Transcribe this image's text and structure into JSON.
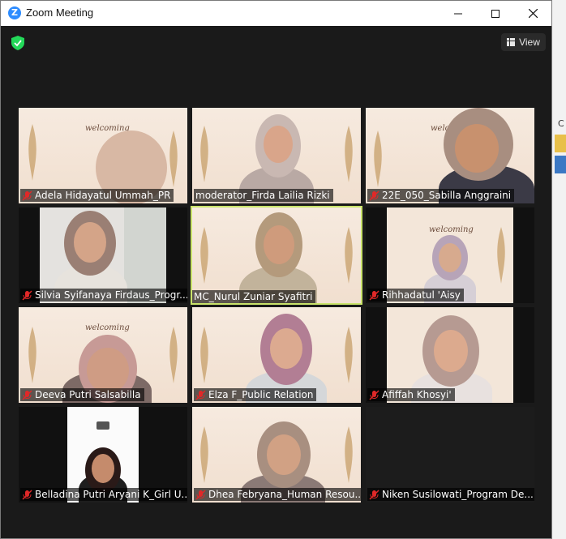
{
  "window": {
    "title": "Zoom Meeting",
    "logo_letter": "Z",
    "controls": [
      "minimize",
      "maximize",
      "close"
    ]
  },
  "toolbar": {
    "view_label": "View",
    "view_icon": "grid-icon",
    "security_icon": "shield-check-icon"
  },
  "desktop": {
    "edge_letter": "C"
  },
  "colors": {
    "accent_active": "#c9e36a",
    "mute_red": "#e02828",
    "zoom_blue": "#2d8cff",
    "shield_green": "#23d959"
  },
  "participants": [
    {
      "name": "Adela Hidayatul Ummah_PR",
      "muted": true
    },
    {
      "name": "moderator_Firda Lailia Rizki",
      "muted": false
    },
    {
      "name": "22E_050_Sabilla Anggraini",
      "muted": true
    },
    {
      "name": "Silvia Syifanaya Firdaus_Progr...",
      "muted": true
    },
    {
      "name": "MC_Nurul Zuniar Syafitri",
      "muted": false,
      "active_speaker": true
    },
    {
      "name": "Rihhadatul 'Aisy",
      "muted": true
    },
    {
      "name": "Deeva Putri Salsabilla",
      "muted": true
    },
    {
      "name": "Elza F_Public Relation",
      "muted": true
    },
    {
      "name": "Afiffah Khosyi'",
      "muted": true
    },
    {
      "name": "Belladina Putri Aryani K_Girl U...",
      "muted": true
    },
    {
      "name": "Dhea Febryana_Human Resou...",
      "muted": true
    },
    {
      "name": "Niken Susilowati_Program De...",
      "muted": true
    }
  ]
}
